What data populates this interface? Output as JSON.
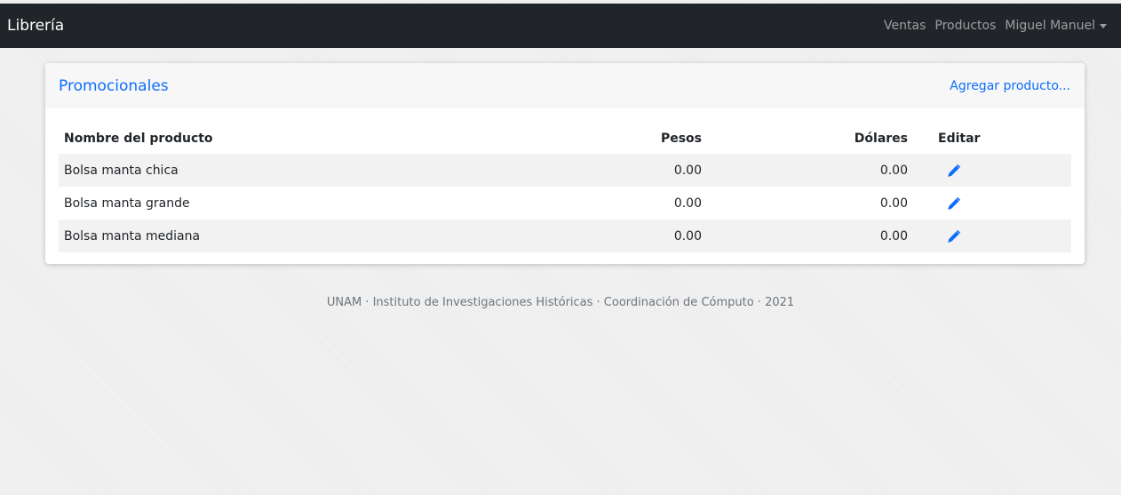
{
  "navbar": {
    "brand": "Librería",
    "links": [
      "Ventas",
      "Productos"
    ],
    "user": "Miguel Manuel"
  },
  "card": {
    "title": "Promocionales",
    "add_link": "Agregar producto..."
  },
  "table": {
    "headers": [
      "Nombre del producto",
      "Pesos",
      "Dólares",
      "Editar"
    ],
    "rows": [
      {
        "name": "Bolsa manta chica",
        "pesos": "0.00",
        "dolares": "0.00",
        "edit_icon": "pencil-icon"
      },
      {
        "name": "Bolsa manta grande",
        "pesos": "0.00",
        "dolares": "0.00",
        "edit_icon": "pencil-icon"
      },
      {
        "name": "Bolsa manta mediana",
        "pesos": "0.00",
        "dolares": "0.00",
        "edit_icon": "pencil-icon"
      }
    ]
  },
  "footer": {
    "text": "UNAM · Instituto de Investigaciones Históricas · Coordinación de Cómputo · 2021"
  },
  "colors": {
    "navbar_bg": "#212529",
    "accent": "#0d6efd",
    "stripe": "#f2f2f2"
  }
}
